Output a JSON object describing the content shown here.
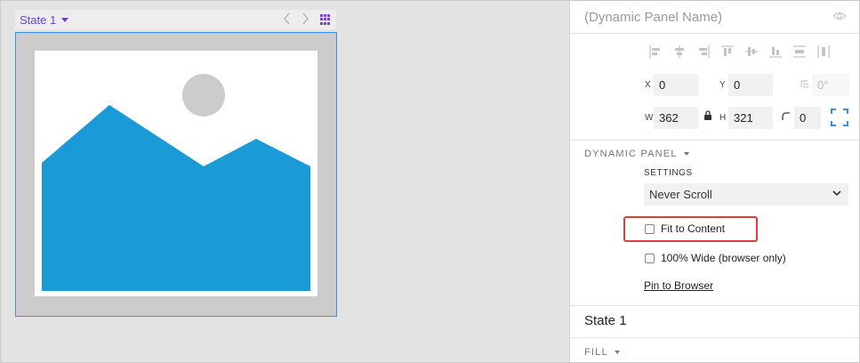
{
  "canvas": {
    "state_label": "State 1",
    "colors": {
      "accent": "#6b3fc8",
      "panel_border": "#3a8ee6",
      "mountain": "#1a9ad6",
      "sun": "#cccccc"
    }
  },
  "right_panel": {
    "panel_name_placeholder": "(Dynamic Panel Name)",
    "position": {
      "x_label": "X",
      "x_value": "0",
      "y_label": "Y",
      "y_value": "0",
      "rotation_value": "0°"
    },
    "size": {
      "w_label": "W",
      "w_value": "362",
      "h_label": "H",
      "h_value": "321",
      "corner_value": "0"
    },
    "dynamic_panel": {
      "section_label": "DYNAMIC PANEL",
      "settings_label": "SETTINGS",
      "scroll_option": "Never Scroll",
      "fit_to_content_label": "Fit to Content",
      "fit_to_content_checked": false,
      "full_wide_label": "100% Wide (browser only)",
      "full_wide_checked": false,
      "pin_to_browser_label": "Pin to Browser"
    },
    "state_title": "State 1",
    "fill_section_label": "FILL",
    "highlight_color": "#e23b3b"
  }
}
